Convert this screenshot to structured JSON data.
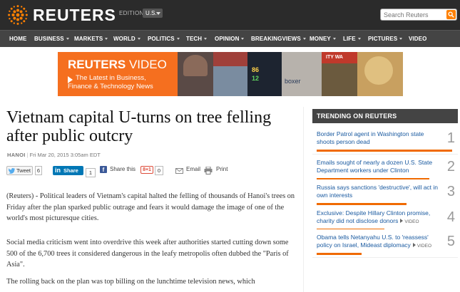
{
  "header": {
    "logo_text": "REUTERS",
    "edition_label": "EDITION:",
    "edition_value": "U.S.",
    "search_placeholder": "Search Reuters",
    "accent_color": "#ff8000"
  },
  "nav": {
    "items": [
      {
        "label": "HOME",
        "dropdown": false
      },
      {
        "label": "BUSINESS",
        "dropdown": true
      },
      {
        "label": "MARKETS",
        "dropdown": true
      },
      {
        "label": "WORLD",
        "dropdown": true
      },
      {
        "label": "POLITICS",
        "dropdown": true
      },
      {
        "label": "TECH",
        "dropdown": true
      },
      {
        "label": "OPINION",
        "dropdown": true
      },
      {
        "label": "BREAKINGVIEWS",
        "dropdown": true
      },
      {
        "label": "MONEY",
        "dropdown": true
      },
      {
        "label": "LIFE",
        "dropdown": true
      },
      {
        "label": "PICTURES",
        "dropdown": true
      },
      {
        "label": "VIDEO",
        "dropdown": false
      }
    ]
  },
  "banner": {
    "title_bold": "REUTERS",
    "title_light": " VIDEO",
    "line1": "The Latest in Business,",
    "line2": "Finance & Technology News",
    "tile_texts": [
      "86",
      "12",
      "boxer",
      "ITY WA"
    ]
  },
  "article": {
    "headline": "Vietnam capital U-turns on tree felling after public outcry",
    "place": "HANOI",
    "date": "Fri Mar 20, 2015 3:05am EDT",
    "paragraphs": [
      "(Reuters) - Political leaders of Vietnam's capital halted the felling of thousands of Hanoi's trees on Friday after the plan sparked public outrage and fears it would damage the image of one of the world's most picturesque cities.",
      "Social media criticism went into overdrive this week after authorities started cutting down some 500 of the 6,700 trees it considered dangerous in the leafy metropolis often dubbed the \"Paris of Asia\".",
      "The rolling back on the plan was top billing on the lunchtime television news, which"
    ]
  },
  "share": {
    "tweet_label": "Tweet",
    "tweet_count": "6",
    "linkedin_in": "in",
    "linkedin_label": "Share",
    "linkedin_count": "1",
    "facebook_label": "Share this",
    "gplus_label": "8+1",
    "gplus_count": "0",
    "email_label": "Email",
    "print_label": "Print"
  },
  "trending": {
    "title": "TRENDING ON REUTERS",
    "video_label": "VIDEO",
    "items": [
      {
        "num": "1",
        "text": "Border Patrol agent in Washington state shoots person dead",
        "bar": 1.0,
        "video": false
      },
      {
        "num": "2",
        "text": "Emails sought of nearly a dozen U.S. State Department workers under Clinton",
        "bar": 0.83,
        "video": false
      },
      {
        "num": "3",
        "text": "Russia says sanctions 'destructive', will act in own interests",
        "bar": 0.66,
        "video": false
      },
      {
        "num": "4",
        "text": "Exclusive: Despite Hillary Clinton promise, charity did not disclose donors",
        "bar": 0.5,
        "video": true
      },
      {
        "num": "5",
        "text": "Obama tells Netanyahu U.S. to 'reassess' policy on Israel, Mideast diplomacy",
        "bar": 0.33,
        "video": true
      }
    ]
  }
}
